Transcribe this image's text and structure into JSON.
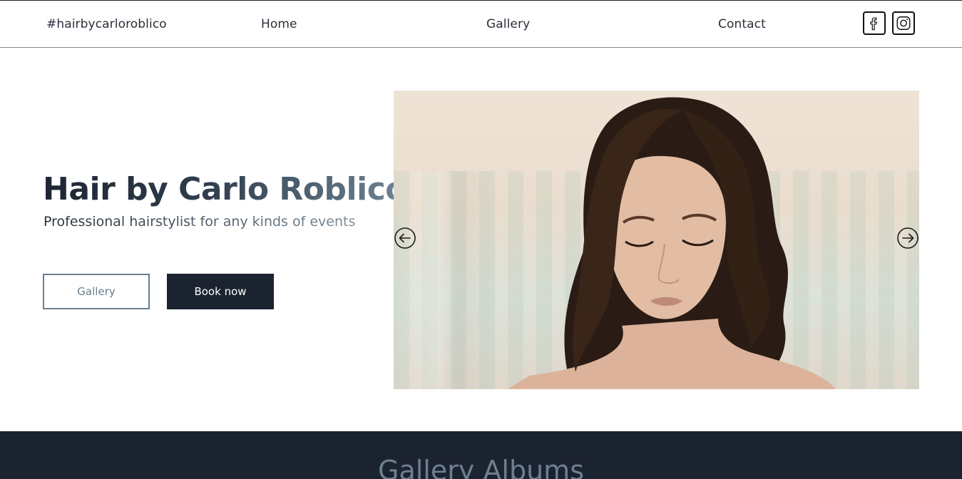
{
  "nav": {
    "brand": "#hairbycarloroblico",
    "links": [
      "Home",
      "Gallery",
      "Contact"
    ],
    "social_icons": [
      "facebook-icon",
      "instagram-icon"
    ]
  },
  "hero": {
    "title": "Hair by Carlo Roblico",
    "subtitle": "Professional hairstylist for any kinds of events",
    "buttons": {
      "gallery": "Gallery",
      "book": "Book now"
    }
  },
  "slider": {
    "prev_icon": "arrow-left-circle-icon",
    "next_icon": "arrow-right-circle-icon"
  },
  "gallery_section": {
    "heading": "Gallery Albums"
  },
  "colors": {
    "dark": "#1b2230",
    "accent": "#6a7f8f",
    "white": "#ffffff"
  }
}
